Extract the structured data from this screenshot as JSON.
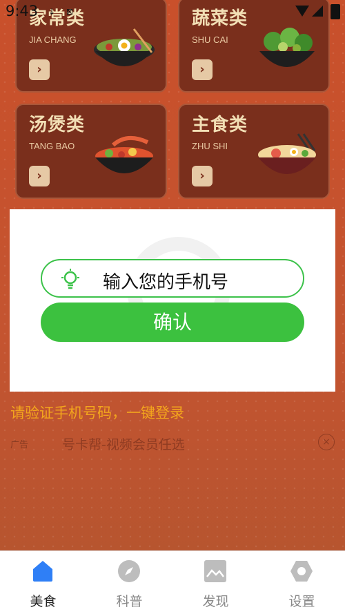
{
  "status_bar": {
    "time": "9:43",
    "mini_a": "↓",
    "mini_b": "⊠"
  },
  "categories": [
    {
      "title": "家常类",
      "subtitle": "JIA CHANG",
      "arrow": "›"
    },
    {
      "title": "蔬菜类",
      "subtitle": "SHU CAI",
      "arrow": "›"
    },
    {
      "title": "汤煲类",
      "subtitle": "TANG BAO",
      "arrow": "›"
    },
    {
      "title": "主食类",
      "subtitle": "ZHU SHI",
      "arrow": "›"
    }
  ],
  "login_dialog": {
    "input_placeholder": "输入您的手机号",
    "confirm_label": "确认"
  },
  "hint_text": "请验证手机号码，一键登录",
  "ad": {
    "tag": "广告",
    "text": "号卡帮-视频会员任选",
    "close": "×"
  },
  "tabs": [
    {
      "label": "美食",
      "icon": "home-icon",
      "active": true
    },
    {
      "label": "科普",
      "icon": "compass-icon",
      "active": false
    },
    {
      "label": "发现",
      "icon": "picture-icon",
      "active": false
    },
    {
      "label": "设置",
      "icon": "settings-icon",
      "active": false
    }
  ],
  "colors": {
    "accent_green": "#3cc13f",
    "tab_active": "#2f7ff6",
    "brand_bg": "#c9502b",
    "hint": "#f3a51d"
  }
}
